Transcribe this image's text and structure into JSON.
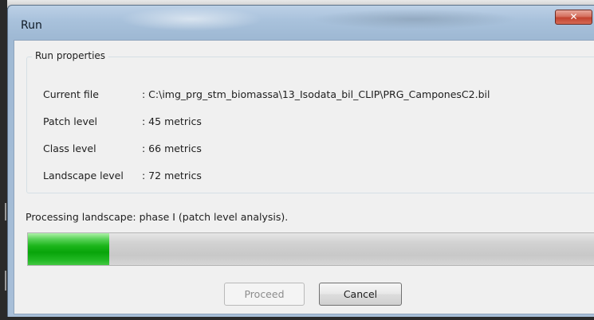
{
  "window": {
    "title": "Run",
    "close_glyph": "✕"
  },
  "group": {
    "legend": "Run properties",
    "rows": [
      {
        "label": "Current file",
        "value": ": C:\\img_prg_stm_biomassa\\13_Isodata_bil_CLIP\\PRG_CamponesC2.bil"
      },
      {
        "label": "Patch level",
        "value": ": 45 metrics"
      },
      {
        "label": "Class level",
        "value": ": 66 metrics"
      },
      {
        "label": "Landscape level",
        "value": ": 72 metrics"
      }
    ]
  },
  "status": {
    "text": "Processing landscape: phase I (patch level analysis)."
  },
  "progress": {
    "fraction": 0.14,
    "fill_color": "#1bb51a"
  },
  "buttons": {
    "proceed_label": "Proceed",
    "proceed_enabled": false,
    "cancel_label": "Cancel"
  },
  "icons": {
    "close": "close-icon"
  }
}
